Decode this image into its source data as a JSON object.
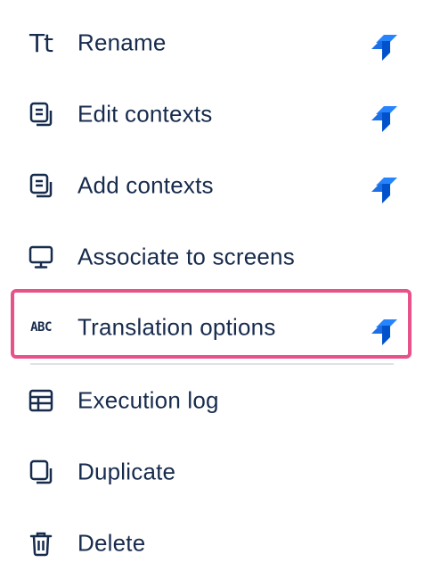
{
  "menu": {
    "items": [
      {
        "label": "Rename",
        "icon": "text-tt-icon",
        "has_jira_badge": true
      },
      {
        "label": "Edit contexts",
        "icon": "copy-document-icon",
        "has_jira_badge": true
      },
      {
        "label": "Add contexts",
        "icon": "copy-document-icon",
        "has_jira_badge": true
      },
      {
        "label": "Associate to screens",
        "icon": "monitor-icon",
        "has_jira_badge": false
      },
      {
        "label": "Translation options",
        "icon": "abc-text-icon",
        "abc_text": "ABC",
        "has_jira_badge": true,
        "highlighted": true
      },
      {
        "label": "Execution log",
        "icon": "table-icon",
        "has_jira_badge": false
      },
      {
        "label": "Duplicate",
        "icon": "duplicate-icon",
        "has_jira_badge": false
      },
      {
        "label": "Delete",
        "icon": "trash-icon",
        "has_jira_badge": false
      }
    ],
    "tt_glyph": "Tt"
  },
  "colors": {
    "text": "#172b4d",
    "highlight_border": "#e8528a",
    "divider": "#dfe1e6",
    "jira_blue_dark": "#2684ff",
    "jira_blue_light": "#0052cc"
  }
}
